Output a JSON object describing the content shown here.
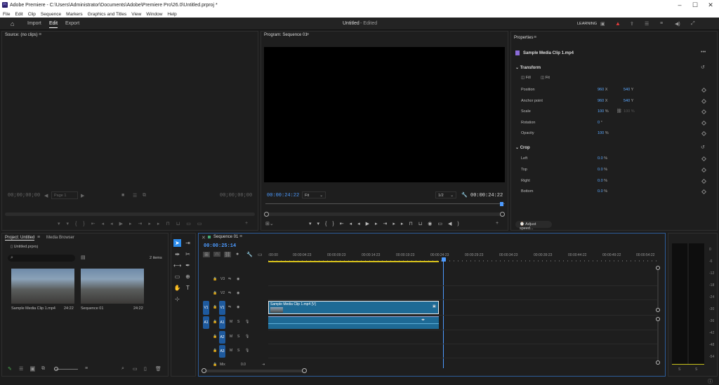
{
  "window": {
    "title": "Adobe Premiere - C:\\Users\\Administrator\\Documents\\Adobe\\Premiere Pro\\26.0\\Untitled.prproj *",
    "app_icon": "Pr",
    "minimize": "–",
    "maximize": "☐",
    "close": "✕"
  },
  "menu": [
    "File",
    "Edit",
    "Clip",
    "Sequence",
    "Markers",
    "Graphics and Titles",
    "View",
    "Window",
    "Help"
  ],
  "header": {
    "import": "Import",
    "edit": "Edit",
    "export": "Export",
    "project_title": "Untitled",
    "project_status": "- Edited",
    "workspace": "LEARNING"
  },
  "source": {
    "title": "Source: (no clips)",
    "tc_left": "00;00;00;00",
    "page": "Page 1",
    "tc_right": "00;00;00;00"
  },
  "program": {
    "title": "Program: Sequence 01",
    "tc_left": "00:00:24:22",
    "fit": "Fit",
    "resolution": "1/2",
    "tc_right": "00:00:24:22"
  },
  "properties": {
    "title": "Properties",
    "clip_name": "Sample Media Clip 1.mp4",
    "transform": "Transform",
    "fill": "Fill",
    "fit": "Fit",
    "rows": [
      {
        "label": "Position",
        "v1": "960",
        "u1": "X",
        "v2": "540",
        "u2": "Y"
      },
      {
        "label": "Anchor point",
        "v1": "960",
        "u1": "X",
        "v2": "540",
        "u2": "Y"
      },
      {
        "label": "Scale",
        "v1": "100",
        "u1": "%",
        "v2": "100",
        "u2": "%"
      },
      {
        "label": "Rotation",
        "v1": "0",
        "u1": "°",
        "v2": "",
        "u2": ""
      },
      {
        "label": "Opacity",
        "v1": "100",
        "u1": "%",
        "v2": "",
        "u2": ""
      }
    ],
    "crop": "Crop",
    "crop_rows": [
      {
        "label": "Left",
        "v": "0.0",
        "u": "%"
      },
      {
        "label": "Top",
        "v": "0.0",
        "u": "%"
      },
      {
        "label": "Right",
        "v": "0.0",
        "u": "%"
      },
      {
        "label": "Bottom",
        "v": "0.0",
        "u": "%"
      }
    ],
    "adjust_speed": "Adjust speed..."
  },
  "project": {
    "tab1": "Project: Untitled",
    "tab2": "Media Browser",
    "file": "Untitled.prproj",
    "items_count": "2 items",
    "items": [
      {
        "name": "Sample Media Clip 1.mp4",
        "duration": "24:22"
      },
      {
        "name": "Sequence 01",
        "duration": "24:22"
      }
    ]
  },
  "timeline": {
    "tab": "Sequence 01",
    "timecode": "00:00:25:14",
    "ruler": [
      ":00:00",
      "00:00:04:23",
      "00:00:09:23",
      "00:00:14:23",
      "00:00:19:23",
      "00:00:24:23",
      "00:00:29:23",
      "00:00:34:23",
      "00:00:39:23",
      "00:00:44:22",
      "00:00:49:22",
      "00:00:54:22"
    ],
    "tracks_video": [
      "V3",
      "V2",
      "V1"
    ],
    "tracks_audio": [
      "A1",
      "A2",
      "A3"
    ],
    "src_v1": "V1",
    "src_a1": "A1",
    "mute": "M",
    "solo": "S",
    "mix_label": "Mix",
    "mix_value": "0.0",
    "clip_label": "Sample Media Clip 1.mp4 [V]"
  },
  "meter": {
    "labels": [
      "0",
      "-6",
      "-12",
      "-18",
      "-24",
      "-30",
      "-36",
      "-42",
      "-48",
      "-54"
    ],
    "s1": "S",
    "s2": "S"
  },
  "colors": {
    "accent": "#2d8ceb",
    "clip": "#1e6a95",
    "playhead": "#4d9bff"
  }
}
